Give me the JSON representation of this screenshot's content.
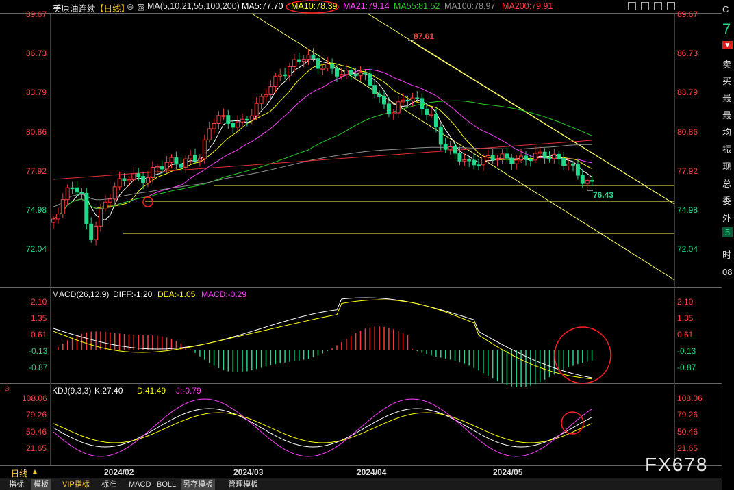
{
  "header": {
    "symbol": "美原油连续",
    "period": "【日线】",
    "ma_params": "MA(5,10,21,55,100,200)",
    "ma5": "MA5:77.70",
    "ma10": "MA10:78.39",
    "ma21": "MA21:79.14",
    "ma55": "MA55:81.52",
    "ma100": "MA100:78.97",
    "ma200": "MA200:79.91"
  },
  "annotations": {
    "high": "87.61",
    "low": "76.43"
  },
  "price_axis": [
    "89.67",
    "86.73",
    "83.79",
    "80.86",
    "77.92",
    "74.98",
    "72.04"
  ],
  "macd": {
    "title": "MACD(26,12,9)",
    "diff": "DIFF:-1.20",
    "dea": "DEA:-1.05",
    "macd": "MACD:-0.29",
    "axis": [
      "2.10",
      "1.35",
      "0.61",
      "-0.13",
      "-0.87"
    ]
  },
  "kdj": {
    "title": "KDJ(9,3,3)",
    "k": "K:27.40",
    "d": "D:41.49",
    "j": "J:-0.79",
    "axis": [
      "108.06",
      "79.26",
      "50.46",
      "21.65"
    ]
  },
  "date_axis": [
    "2024/02",
    "2024/03",
    "2024/04",
    "2024/05"
  ],
  "bottom_bar": {
    "period_label": "日线",
    "tabs": [
      "指标",
      "模板",
      "VIP指标",
      "标准",
      "MACD",
      "BOLL",
      "另存模板",
      "管理模板"
    ]
  },
  "right_panel": {
    "symbol_letter": "C",
    "price_digit": "7",
    "rows": [
      "卖",
      "买",
      "最",
      "最",
      "均",
      "振",
      "现",
      "总",
      "委",
      "外"
    ],
    "bottom": [
      "5",
      "时",
      "08"
    ]
  },
  "watermark": "FX678",
  "colors": {
    "up": "#ff3a3a",
    "down": "#22d68a",
    "ma5": "#ffffff",
    "ma10": "#ffff00",
    "ma21": "#ff40ff",
    "ma55": "#22cc22",
    "ma100": "#909090",
    "ma200": "#e03030"
  }
}
